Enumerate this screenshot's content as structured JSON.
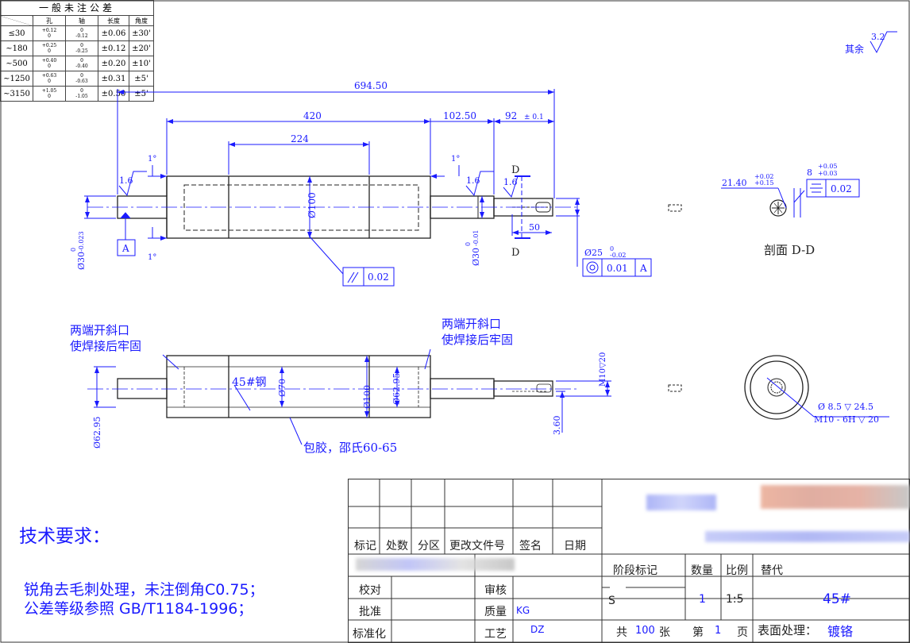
{
  "tolerance_table": {
    "title": "一般未注公差",
    "headers": [
      "孔",
      "轴",
      "长度",
      "角度"
    ],
    "rows": [
      {
        "range": "≤30",
        "hole_upper": "+0.12",
        "hole_lower": "0",
        "shaft_upper": "0",
        "shaft_lower": "-0.12",
        "length": "±0.06",
        "angle": "±30'"
      },
      {
        "range": "~180",
        "hole_upper": "+0.25",
        "hole_lower": "0",
        "shaft_upper": "0",
        "shaft_lower": "-0.25",
        "length": "±0.12",
        "angle": "±20'"
      },
      {
        "range": "~500",
        "hole_upper": "+0.40",
        "hole_lower": "0",
        "shaft_upper": "0",
        "shaft_lower": "-0.40",
        "length": "±0.20",
        "angle": "±10'"
      },
      {
        "range": "~1250",
        "hole_upper": "+0.63",
        "hole_lower": "0",
        "shaft_upper": "0",
        "shaft_lower": "-0.63",
        "length": "±0.31",
        "angle": "±5'"
      },
      {
        "range": "~3150",
        "hole_upper": "+1.05",
        "hole_lower": "0",
        "shaft_upper": "0",
        "shaft_lower": "-1.05",
        "length": "±0.50",
        "angle": "±5'"
      }
    ]
  },
  "roughness": {
    "label": "其余",
    "value": "3.2"
  },
  "dimensions": {
    "overall": "694.50",
    "body": "420",
    "center": "224",
    "right_step": "102.50",
    "journal": "92",
    "journal_tol": "± 0.1",
    "keyway": "50",
    "dia_main": "Ø100",
    "dia_left": "Ø30",
    "dia_left_tol_upper": "0",
    "dia_left_tol_lower": "-0.023",
    "dia_right": "Ø30",
    "dia_right_tol_upper": "0",
    "dia_right_tol_lower": "-0.01",
    "dia_end": "Ø25",
    "dia_end_tol_upper": "0",
    "dia_end_tol_lower": "-0.02",
    "chamfer_angle": "1°",
    "rough_a": "1.6"
  },
  "gdt": {
    "runout": "0.02",
    "concentricity": "0.01",
    "concentricity_datum": "A",
    "symmetry": "0.02",
    "datum": "A"
  },
  "section": {
    "marker": "D",
    "title": "剖面 D-D",
    "depth": "21.40",
    "depth_upper": "+0.02",
    "depth_lower": "+0.15",
    "width": "8",
    "width_upper": "+0.05",
    "width_lower": "+0.03"
  },
  "lower_view": {
    "note_left_1": "两端开斜口",
    "note_left_2": "使焊接后牢固",
    "note_right_1": "两端开斜口",
    "note_right_2": "使焊接后牢固",
    "material": "45#钢",
    "coating": "包胶，邵氏60-65",
    "dia_70": "Ø70",
    "dia_100": "Ø100",
    "dia_6295_inner": "Ø62.95",
    "dia_6295_outer": "Ø62.95",
    "thread": "M10▽20",
    "offset": "3.60"
  },
  "end_view": {
    "hole": "Ø 8.5 ▽ 24.5",
    "thread": "M10 - 6H ▽ 20"
  },
  "tech": {
    "heading": "技术要求：",
    "line1": "锐角去毛刺处理，未注倒角C0.75；",
    "line2": "公差等级参照 GB/T1184-1996；"
  },
  "title_block": {
    "mark": "标记",
    "count": "处数",
    "zone": "分区",
    "change_no": "更改文件号",
    "sign": "签名",
    "date": "日期",
    "check": "校对",
    "review": "审核",
    "approve": "批准",
    "quality": "质量",
    "quality_val": "KG",
    "standard": "标准化",
    "process": "工艺",
    "process_val": "DZ",
    "stage": "阶段标记",
    "qty": "数量",
    "scale": "比例",
    "replace": "替代",
    "stage_val": "S",
    "qty_val": "1",
    "scale_val": "1:5",
    "material": "45#",
    "total_pre": "共",
    "total_val": "100",
    "total_unit": "张",
    "page_pre": "第",
    "page_val": "1",
    "page_unit": "页",
    "surface_label": "表面处理：",
    "surface_val": "镀铬"
  },
  "colors": {
    "line": "#1a1aff",
    "dark": "#222222",
    "red": "#e06060"
  }
}
